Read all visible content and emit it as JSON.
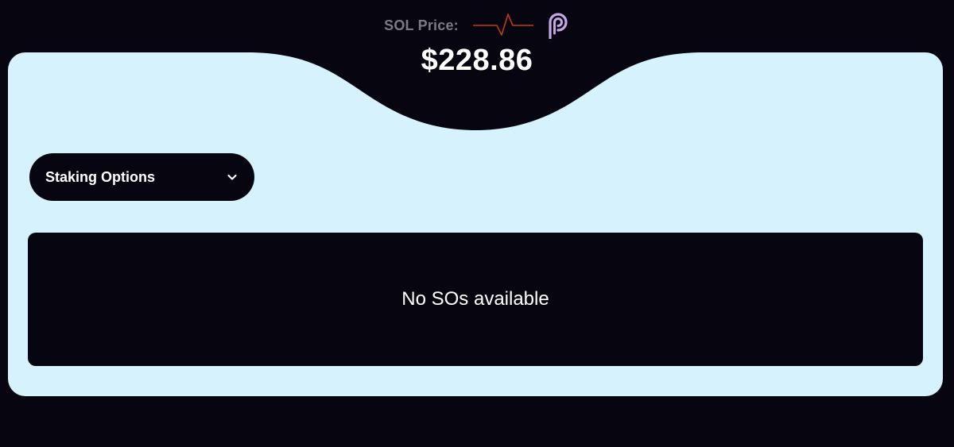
{
  "price": {
    "label": "SOL Price:",
    "value": "$228.86",
    "pulse_icon": "heartbeat-pulse-icon",
    "provider_icon": "pyth-logo-icon",
    "pulse_color": "#c0381f",
    "provider_icon_color": "#c7a6e6"
  },
  "staking": {
    "dropdown_label": "Staking Options",
    "dropdown_icon": "chevron-down-icon"
  },
  "list": {
    "empty_message": "No SOs available"
  },
  "colors": {
    "background": "#070610",
    "panel": "#d6f3fd",
    "text_primary": "#ffffff",
    "text_muted": "#7b7b86"
  }
}
